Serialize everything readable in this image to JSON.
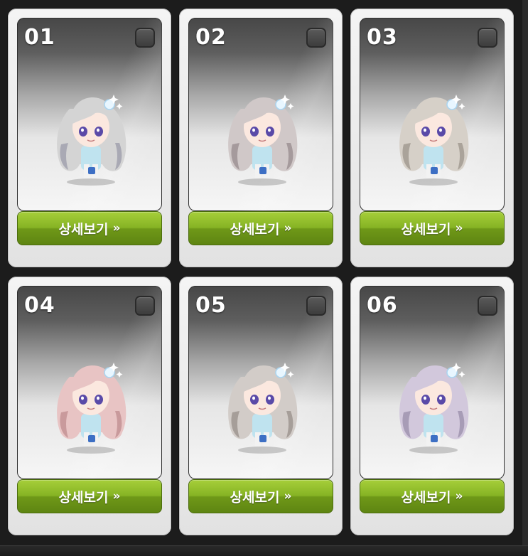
{
  "cards": [
    {
      "number": "01",
      "button_label": "상세보기",
      "arrows": "»",
      "hair_color": "#d4d4d4",
      "hair_shade": "#a9a9b4"
    },
    {
      "number": "02",
      "button_label": "상세보기",
      "arrows": "»",
      "hair_color": "#d0c8c8",
      "hair_shade": "#a59a9c"
    },
    {
      "number": "03",
      "button_label": "상세보기",
      "arrows": "»",
      "hair_color": "#d6d0c8",
      "hair_shade": "#aaa39a"
    },
    {
      "number": "04",
      "button_label": "상세보기",
      "arrows": "»",
      "hair_color": "#e8c4c4",
      "hair_shade": "#c99a9c"
    },
    {
      "number": "05",
      "button_label": "상세보기",
      "arrows": "»",
      "hair_color": "#d2ccc8",
      "hair_shade": "#a69e99"
    },
    {
      "number": "06",
      "button_label": "상세보기",
      "arrows": "»",
      "hair_color": "#d2c8dc",
      "hair_shade": "#a79cb6"
    }
  ],
  "colors": {
    "button_green": "#86b324",
    "card_bg": "#ececec",
    "panel_dark": "#474747",
    "outfit_blue": "#bfe3ef"
  }
}
